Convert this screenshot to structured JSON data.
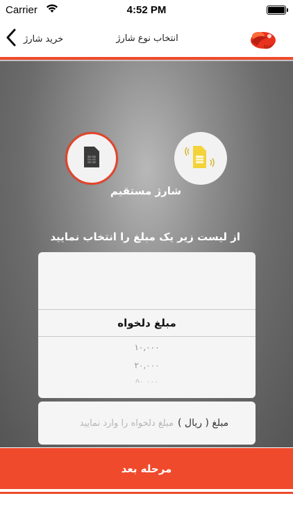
{
  "status_bar": {
    "carrier": "Carrier",
    "time": "4:52 PM",
    "wifi_icon": "wifi-icon",
    "battery_icon": "battery-icon"
  },
  "nav": {
    "back_label": "خرید شارژ",
    "title": "انتخاب نوع شارژ",
    "back_icon": "chevron-left-icon",
    "logo_icon": "brand-logo"
  },
  "charge_types": {
    "direct_label": "شارژ مستقیم",
    "direct_icon": "sim-card-icon",
    "topup_icon": "sim-card-signal-icon"
  },
  "instruction": "از لیست زیر یک مبلغ را انتخاب نمایید",
  "picker": {
    "selected": "مبلغ دلخواه",
    "options": [
      "۱۰,۰۰۰",
      "۲۰,۰۰۰",
      "۵۰,۰۰۰"
    ]
  },
  "amount_field": {
    "label": "مبلغ ( ریال )",
    "placeholder": "مبلغ دلخواه را وارد نمایید",
    "value": ""
  },
  "next_button": "مرحله بعد",
  "colors": {
    "accent": "#f04a2c",
    "background": "#6a6a6a",
    "sim_yellow": "#f4d33a",
    "sim_dark": "#3a3a3a"
  }
}
